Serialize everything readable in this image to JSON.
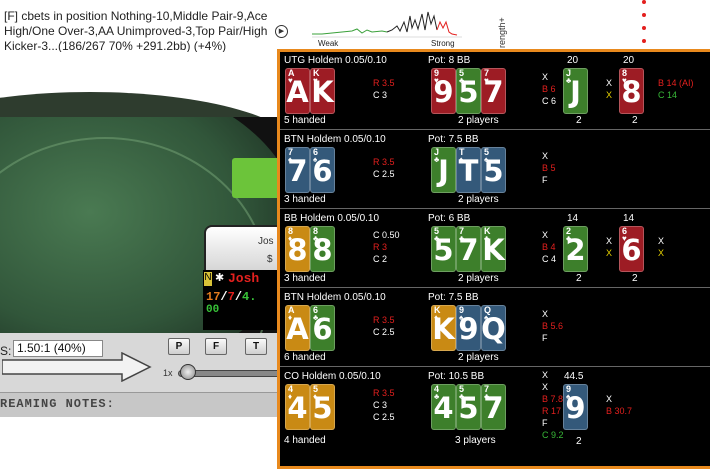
{
  "topbar": {
    "stat_description": "[F] cbets in position Nothing-10,Middle Pair-9,Ace High/One Over-3,AA Unimproved-3,Top Pair/High Kicker-3...(186/267 70% +291.2bb) (+4%)",
    "graph_weak": "Weak",
    "graph_strong": "Strong",
    "vertical_label": "rength+"
  },
  "table": {
    "player_name": "Jos",
    "player_amount": "$",
    "hud_position": "N",
    "hud_name": "Josh",
    "hud_stats": {
      "a": "17",
      "sep1": "/",
      "b": "7",
      "sep2": "/",
      "c": "4."
    },
    "hud_extra": "00",
    "odds_label": "S:",
    "odds_value": "1.50:1 (40%)",
    "btn_p": "P",
    "btn_f": "F",
    "btn_t": "T",
    "slider_label": "1x",
    "notes_label": "REAMING NOTES:"
  },
  "colors": {
    "spades": "#34597a",
    "hearts": "#9d1c24",
    "clubs": "#3d7f2b",
    "diamonds": "#2a568c",
    "popup_border": "#e8891d",
    "action_red": "#e3201e",
    "action_green": "#38b838",
    "action_yellow": "#e5d000"
  },
  "hands": [
    {
      "title": "UTG Holdem 0.05/0.10",
      "pot": "Pot: 8 BB",
      "handed": "5 handed",
      "players": "2 players",
      "hole": [
        {
          "rank": "A",
          "suit": "♥"
        },
        {
          "rank": "K",
          "suit": "♥"
        }
      ],
      "pre": [
        "R 3.5",
        "C 3"
      ],
      "flop": [
        {
          "rank": "9",
          "suit": "♥"
        },
        {
          "rank": "5",
          "suit": "♣"
        },
        {
          "rank": "7",
          "suit": "♥"
        }
      ],
      "flop_act": [
        "X",
        "B 6",
        "C 6"
      ],
      "turn_head": "20",
      "turn": {
        "rank": "J",
        "suit": "♣"
      },
      "turn_act": [
        "X",
        "X"
      ],
      "turn_foot": "2",
      "river_head": "20",
      "river": {
        "rank": "8",
        "suit": "♥"
      },
      "river_act": [
        "B 14 (AI)",
        "C 14"
      ],
      "river_foot": "2"
    },
    {
      "title": "BTN Holdem 0.05/0.10",
      "pot": "Pot: 7.5 BB",
      "handed": "3 handed",
      "players": "2 players",
      "hole": [
        {
          "rank": "7",
          "suit": "♠"
        },
        {
          "rank": "6",
          "suit": "♠"
        }
      ],
      "pre": [
        "R 3.5",
        "C 2.5"
      ],
      "flop": [
        {
          "rank": "J",
          "suit": "♣"
        },
        {
          "rank": "T",
          "suit": "♠"
        },
        {
          "rank": "5",
          "suit": "♠"
        }
      ],
      "flop_act": [
        "X",
        "B 5",
        "F"
      ]
    },
    {
      "title": "BB Holdem 0.05/0.10",
      "pot": "Pot: 6 BB",
      "handed": "3 handed",
      "players": "2 players",
      "hole": [
        {
          "rank": "8",
          "suit": "♦"
        },
        {
          "rank": "8",
          "suit": "♣"
        }
      ],
      "pre": [
        "C 0.50",
        "R 3",
        "C 2"
      ],
      "flop": [
        {
          "rank": "5",
          "suit": "♣"
        },
        {
          "rank": "7",
          "suit": "♣"
        },
        {
          "rank": "K",
          "suit": "♣"
        }
      ],
      "flop_act": [
        "X",
        "B 4",
        "C 4"
      ],
      "turn_head": "14",
      "turn": {
        "rank": "2",
        "suit": "♣"
      },
      "turn_act": [
        "X",
        "X"
      ],
      "turn_foot": "2",
      "river_head": "14",
      "river": {
        "rank": "6",
        "suit": "♥"
      },
      "river_act": [
        "X",
        "X"
      ],
      "river_foot": "2"
    },
    {
      "title": "BTN Holdem 0.05/0.10",
      "pot": "Pot: 7.5 BB",
      "handed": "6 handed",
      "players": "2 players",
      "hole": [
        {
          "rank": "A",
          "suit": "♦"
        },
        {
          "rank": "6",
          "suit": "♣"
        }
      ],
      "pre": [
        "R 3.5",
        "C 2.5"
      ],
      "flop": [
        {
          "rank": "K",
          "suit": "♦"
        },
        {
          "rank": "9",
          "suit": "♠"
        },
        {
          "rank": "Q",
          "suit": "♠"
        }
      ],
      "flop_act": [
        "X",
        "B 5.6",
        "F"
      ]
    },
    {
      "title": "CO Holdem 0.05/0.10",
      "pot": "Pot: 10.5 BB",
      "handed": "4 handed",
      "players": "3 players",
      "hole": [
        {
          "rank": "4",
          "suit": "♦"
        },
        {
          "rank": "5",
          "suit": "♦"
        }
      ],
      "pre": [
        "R 3.5",
        "C 3",
        "C 2.5"
      ],
      "flop": [
        {
          "rank": "4",
          "suit": "♣"
        },
        {
          "rank": "5",
          "suit": "♣"
        },
        {
          "rank": "7",
          "suit": "♣"
        }
      ],
      "flop_act": [
        "X",
        "X",
        "B 7.8",
        "R 17",
        "F",
        "C 9.2"
      ],
      "turn_head": "44.5",
      "turn": {
        "rank": "9",
        "suit": "♠"
      },
      "turn_act": [
        "X",
        "B 30.7"
      ],
      "turn_foot": "2"
    }
  ]
}
